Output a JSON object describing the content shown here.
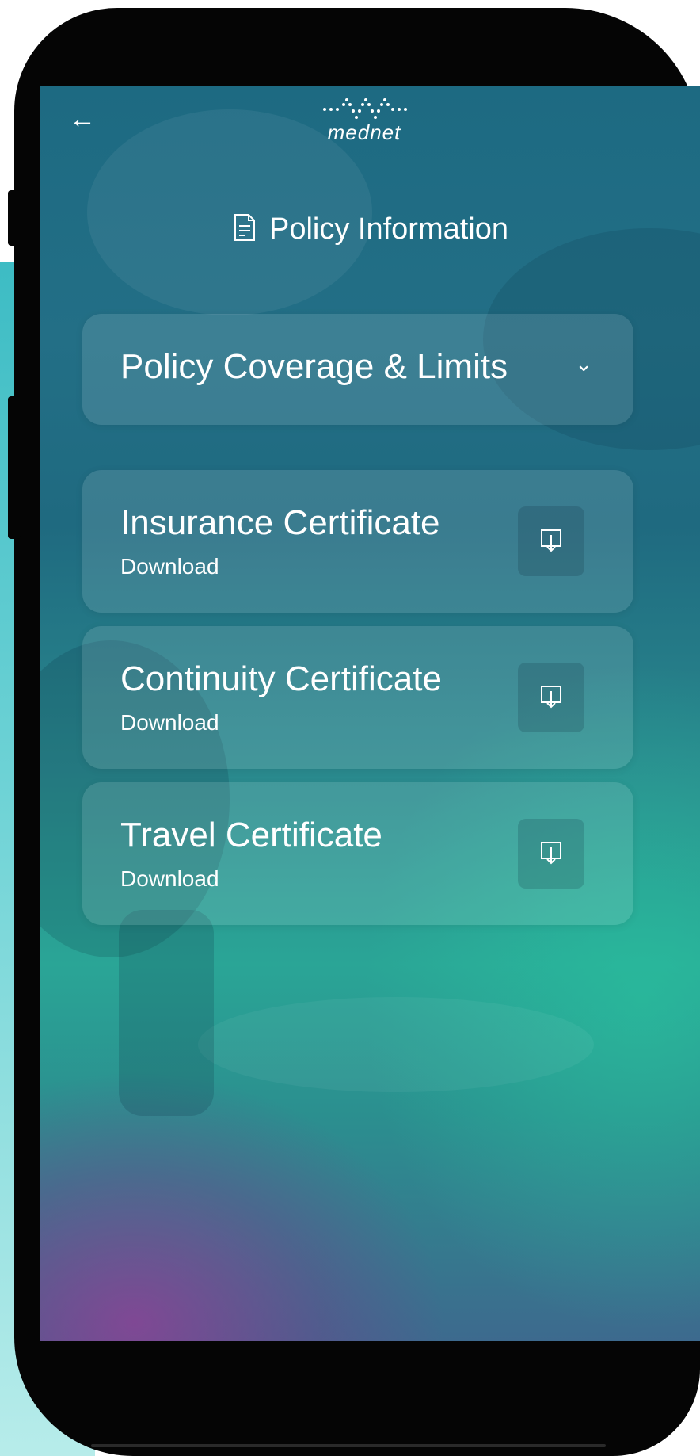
{
  "header": {
    "back_icon": "arrow-left-icon",
    "logo_text": "mednet"
  },
  "page": {
    "title": "Policy Information",
    "title_icon": "document-icon"
  },
  "accordion": {
    "label": "Policy Coverage & Limits",
    "icon": "chevron-down-icon"
  },
  "certificates": [
    {
      "title": "Insurance Certificate",
      "action": "Download",
      "icon": "download-icon"
    },
    {
      "title": "Continuity Certificate",
      "action": "Download",
      "icon": "download-icon"
    },
    {
      "title": "Travel Certificate",
      "action": "Download",
      "icon": "download-icon"
    }
  ],
  "colors": {
    "background_teal": "#1f6a80",
    "background_green": "#2aa596",
    "accent_purple": "#963c96",
    "text": "#ffffff",
    "phone_frame": "#050505"
  }
}
